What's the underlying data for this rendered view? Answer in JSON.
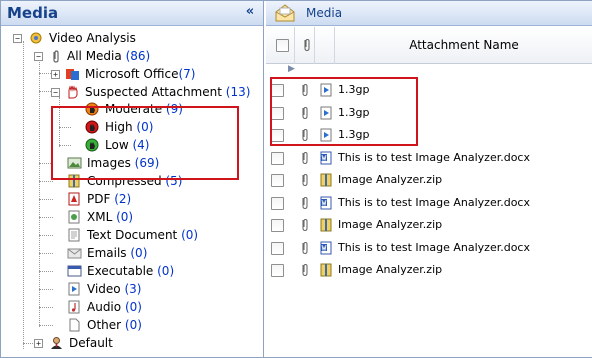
{
  "left_panel": {
    "title": "Media",
    "collapse_glyph": "«"
  },
  "tree": {
    "root": {
      "label": "Video Analysis",
      "icon": "video-analysis-icon"
    },
    "all_media": {
      "label": "All Media",
      "count": "(86)",
      "icon": "paperclip-icon"
    },
    "microsoft_office": {
      "label": "Microsoft Office",
      "count": "(7)"
    },
    "suspected": {
      "label": "Suspected Attachment",
      "count": "(13)"
    },
    "moderate": {
      "label": "Moderate",
      "count": "(9)"
    },
    "high": {
      "label": "High",
      "count": "(0)"
    },
    "low": {
      "label": "Low",
      "count": "(4)"
    },
    "images": {
      "label": "Images",
      "count": "(69)"
    },
    "compressed": {
      "label": "Compressed",
      "count": "(5)"
    },
    "pdf": {
      "label": "PDF",
      "count": "(2)"
    },
    "xml": {
      "label": "XML",
      "count": "(0)"
    },
    "text_document": {
      "label": "Text Document",
      "count": "(0)"
    },
    "emails": {
      "label": "Emails",
      "count": "(0)"
    },
    "executable": {
      "label": "Executable",
      "count": "(0)"
    },
    "video": {
      "label": "Video",
      "count": "(3)"
    },
    "audio": {
      "label": "Audio",
      "count": "(0)"
    },
    "other": {
      "label": "Other",
      "count": "(0)"
    },
    "default": {
      "label": "Default"
    }
  },
  "right_panel": {
    "title": "Media",
    "column_name": "Attachment Name",
    "rows": [
      {
        "name": "1.3gp",
        "type": "video"
      },
      {
        "name": "1.3gp",
        "type": "video"
      },
      {
        "name": "1.3gp",
        "type": "video"
      },
      {
        "name": "This is to test Image Analyzer.docx",
        "type": "docx"
      },
      {
        "name": "Image Analyzer.zip",
        "type": "zip"
      },
      {
        "name": "This is to test Image Analyzer.docx",
        "type": "docx"
      },
      {
        "name": "Image Analyzer.zip",
        "type": "zip"
      },
      {
        "name": "This is to test Image Analyzer.docx",
        "type": "docx"
      },
      {
        "name": "Image Analyzer.zip",
        "type": "zip"
      }
    ]
  },
  "colors": {
    "header_text": "#15428b",
    "count_text": "#0033cc",
    "highlight_box": "#d0141c"
  }
}
